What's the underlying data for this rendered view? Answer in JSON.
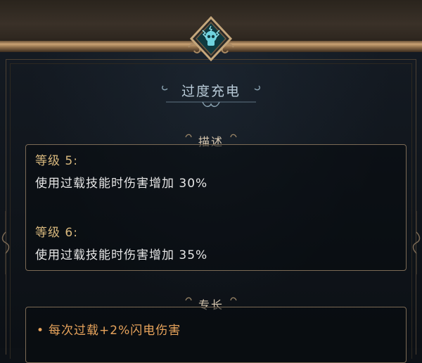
{
  "skill": {
    "title": "过度充电",
    "emblem_icon": "lightning-skull-icon"
  },
  "description": {
    "heading": "描述",
    "levels": [
      {
        "level_label": "等级 5:",
        "effect": "使用过载技能时伤害增加 30%"
      },
      {
        "level_label": "等级 6:",
        "effect": "使用过载技能时伤害增加 35%"
      }
    ]
  },
  "specialty": {
    "heading": "专长",
    "bullet_icon": "dot-bullet-icon",
    "items": [
      "每次过载+2%闪电伤害"
    ]
  },
  "colors": {
    "level_label": "#d9b97e",
    "effect_text": "#e6e6e6",
    "perk_text": "#e8a45c",
    "title_text": "#b9cbd8",
    "border_gold": "#7b6a55"
  }
}
